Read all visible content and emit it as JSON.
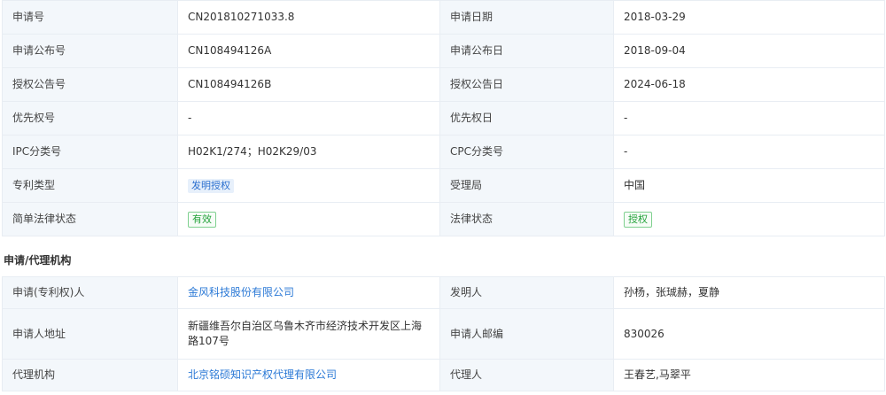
{
  "basic": {
    "app_no_label": "申请号",
    "app_no": "CN201810271033.8",
    "app_date_label": "申请日期",
    "app_date": "2018-03-29",
    "pub_no_label": "申请公布号",
    "pub_no": "CN108494126A",
    "pub_date_label": "申请公布日",
    "pub_date": "2018-09-04",
    "grant_no_label": "授权公告号",
    "grant_no": "CN108494126B",
    "grant_date_label": "授权公告日",
    "grant_date": "2024-06-18",
    "priority_no_label": "优先权号",
    "priority_no": "-",
    "priority_date_label": "优先权日",
    "priority_date": "-",
    "ipc_label": "IPC分类号",
    "ipc": "H02K1/274；H02K29/03",
    "cpc_label": "CPC分类号",
    "cpc": "-",
    "patent_type_label": "专利类型",
    "patent_type": "发明授权",
    "office_label": "受理局",
    "office": "中国",
    "simple_status_label": "简单法律状态",
    "simple_status": "有效",
    "legal_status_label": "法律状态",
    "legal_status": "授权"
  },
  "agency": {
    "section_title": "申请/代理机构",
    "applicant_label": "申请(专利权)人",
    "applicant": "金风科技股份有限公司",
    "inventor_label": "发明人",
    "inventor": "孙杨，张珹赫，夏静",
    "address_label": "申请人地址",
    "address": "新疆维吾尔自治区乌鲁木齐市经济技术开发区上海路107号",
    "postcode_label": "申请人邮编",
    "postcode": "830026",
    "agency_label": "代理机构",
    "agency": "北京铭硕知识产权代理有限公司",
    "agent_label": "代理人",
    "agent": "王春艺,马翠平"
  },
  "colors": {
    "label_bg": "#f3f7fb",
    "border": "#e8edf3",
    "link": "#2b79d6",
    "tag_blue_bg": "#e7f0fb",
    "tag_green": "#23a23a"
  }
}
